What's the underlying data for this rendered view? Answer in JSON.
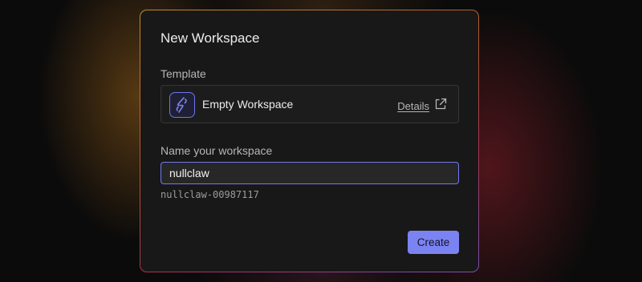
{
  "dialog": {
    "title": "New Workspace"
  },
  "template": {
    "section_label": "Template",
    "name": "Empty Workspace",
    "icon": "workspace-logo-icon",
    "details_label": "Details",
    "details_icon": "external-link-icon"
  },
  "workspace_name": {
    "section_label": "Name your workspace",
    "value": "nullclaw",
    "slug": "nullclaw-00987117"
  },
  "actions": {
    "create_label": "Create"
  },
  "colors": {
    "accent": "#7b83f2",
    "input_border": "#7479ee",
    "card_bg": "#181818"
  }
}
